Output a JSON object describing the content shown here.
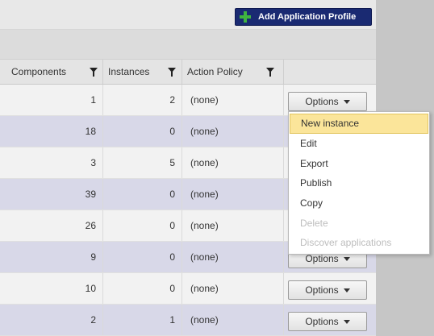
{
  "toolbar": {
    "add_label": "Add Application Profile"
  },
  "columns": {
    "components": "Components",
    "instances": "Instances",
    "action_policy": "Action Policy"
  },
  "rows": [
    {
      "components": "1",
      "instances": "2",
      "policy": "(none)"
    },
    {
      "components": "18",
      "instances": "0",
      "policy": "(none)"
    },
    {
      "components": "3",
      "instances": "5",
      "policy": "(none)"
    },
    {
      "components": "39",
      "instances": "0",
      "policy": "(none)"
    },
    {
      "components": "26",
      "instances": "0",
      "policy": "(none)"
    },
    {
      "components": "9",
      "instances": "0",
      "policy": "(none)"
    },
    {
      "components": "10",
      "instances": "0",
      "policy": "(none)"
    },
    {
      "components": "2",
      "instances": "1",
      "policy": "(none)"
    }
  ],
  "options_label": "Options",
  "menu": {
    "items": [
      {
        "label": "New instance"
      },
      {
        "label": "Edit"
      },
      {
        "label": "Export"
      },
      {
        "label": "Publish"
      },
      {
        "label": "Copy"
      },
      {
        "label": "Delete"
      },
      {
        "label": "Discover applications"
      }
    ]
  }
}
